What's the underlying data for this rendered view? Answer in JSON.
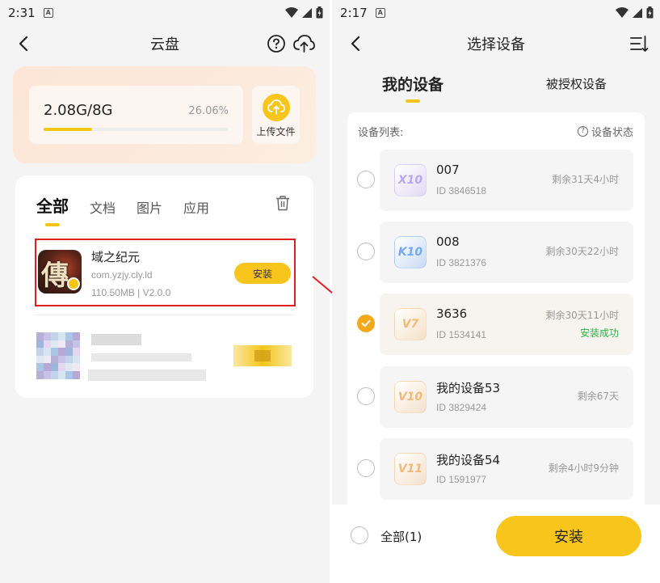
{
  "left": {
    "status_time": "2:31",
    "title": "云盘",
    "storage": {
      "used": "2.08G/8G",
      "percent_label": "26.06%",
      "fill_fraction": 0.2606
    },
    "upload_label": "上传文件",
    "tabs": [
      "全部",
      "文档",
      "图片",
      "应用"
    ],
    "app": {
      "name": "域之纪元",
      "package": "com.yzjy.cly.ld",
      "meta": "110.50MB | V2.0.0",
      "install_label": "安装"
    }
  },
  "right": {
    "status_time": "2:17",
    "title": "选择设备",
    "seg_tabs": [
      "我的设备",
      "被授权设备"
    ],
    "list_label": "设备列表:",
    "status_link": "设备状态",
    "devices": [
      {
        "badge": "X10",
        "name": "007",
        "id": "ID 3846518",
        "remain": "剩余31天4小时",
        "status": "",
        "checked": false,
        "badge_color": "#b9a7f3"
      },
      {
        "badge": "K10",
        "name": "008",
        "id": "ID 3821376",
        "remain": "剩余30天22小时",
        "status": "",
        "checked": false,
        "badge_color": "#74a8ef"
      },
      {
        "badge": "V7",
        "name": "3636",
        "id": "ID 1534141",
        "remain": "剩余30天11小时",
        "status": "安装成功",
        "checked": true,
        "badge_color": "#f3b978"
      },
      {
        "badge": "V10",
        "name": "我的设备53",
        "id": "ID 3829424",
        "remain": "剩余67天",
        "status": "",
        "checked": false,
        "badge_color": "#f3b978"
      },
      {
        "badge": "V11",
        "name": "我的设备54",
        "id": "ID 1591977",
        "remain": "剩余4小时9分钟",
        "status": "",
        "checked": false,
        "badge_color": "#f3b978"
      }
    ],
    "select_all_label": "全部(1)",
    "install_label": "安装"
  },
  "colors": {
    "accent": "#f8c51c",
    "success": "#2ab24a",
    "highlight_box": "#e02020"
  }
}
